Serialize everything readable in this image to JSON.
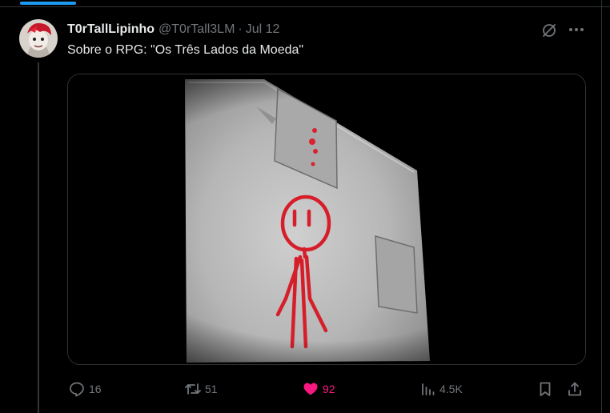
{
  "post": {
    "display_name": "T0rTallLipinho",
    "handle": "@T0rTall3LM",
    "separator": "·",
    "date": "Jul 12",
    "text": "Sobre o RPG: \"Os Três Lados da Moeda\""
  },
  "actions": {
    "replies": "16",
    "reposts": "51",
    "likes": "92",
    "views": "4.5K",
    "liked": true
  },
  "colors": {
    "accent": "#1d9bf0",
    "like": "#f91880",
    "muted": "#71767b",
    "text": "#e7e9ea",
    "border": "#2f3336"
  },
  "icons": [
    "reply-icon",
    "repost-icon",
    "heart-icon",
    "views-icon",
    "bookmark-icon",
    "share-icon",
    "grok-icon",
    "more-icon"
  ]
}
